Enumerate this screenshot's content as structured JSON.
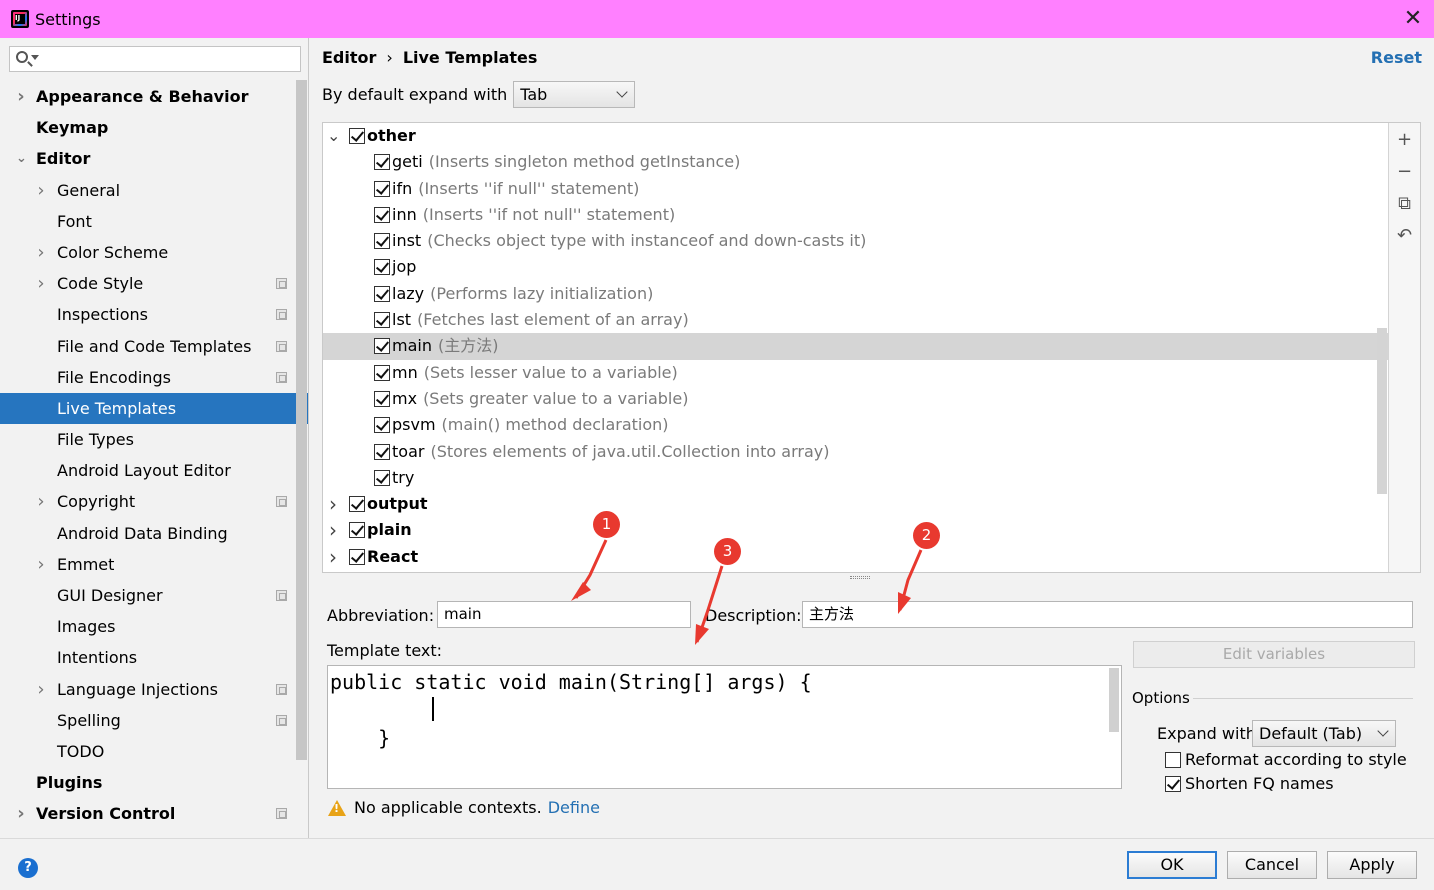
{
  "window": {
    "title": "Settings",
    "close_glyph": "✕"
  },
  "search": {
    "placeholder": ""
  },
  "sidebar": {
    "items": [
      {
        "label": "Appearance & Behavior",
        "level": 0,
        "bold": true,
        "expander": "collapsed",
        "proj": false
      },
      {
        "label": "Keymap",
        "level": 0,
        "bold": true,
        "expander": "none",
        "proj": false
      },
      {
        "label": "Editor",
        "level": 0,
        "bold": true,
        "expander": "expanded",
        "proj": false
      },
      {
        "label": "General",
        "level": 1,
        "bold": false,
        "expander": "collapsed",
        "proj": false
      },
      {
        "label": "Font",
        "level": 1,
        "bold": false,
        "expander": "none",
        "proj": false
      },
      {
        "label": "Color Scheme",
        "level": 1,
        "bold": false,
        "expander": "collapsed",
        "proj": false
      },
      {
        "label": "Code Style",
        "level": 1,
        "bold": false,
        "expander": "collapsed",
        "proj": true
      },
      {
        "label": "Inspections",
        "level": 1,
        "bold": false,
        "expander": "none",
        "proj": true
      },
      {
        "label": "File and Code Templates",
        "level": 1,
        "bold": false,
        "expander": "none",
        "proj": true
      },
      {
        "label": "File Encodings",
        "level": 1,
        "bold": false,
        "expander": "none",
        "proj": true
      },
      {
        "label": "Live Templates",
        "level": 1,
        "bold": false,
        "expander": "none",
        "proj": false,
        "selected": true
      },
      {
        "label": "File Types",
        "level": 1,
        "bold": false,
        "expander": "none",
        "proj": false
      },
      {
        "label": "Android Layout Editor",
        "level": 1,
        "bold": false,
        "expander": "none",
        "proj": false
      },
      {
        "label": "Copyright",
        "level": 1,
        "bold": false,
        "expander": "collapsed",
        "proj": true
      },
      {
        "label": "Android Data Binding",
        "level": 1,
        "bold": false,
        "expander": "none",
        "proj": false
      },
      {
        "label": "Emmet",
        "level": 1,
        "bold": false,
        "expander": "collapsed",
        "proj": false
      },
      {
        "label": "GUI Designer",
        "level": 1,
        "bold": false,
        "expander": "none",
        "proj": true
      },
      {
        "label": "Images",
        "level": 1,
        "bold": false,
        "expander": "none",
        "proj": false
      },
      {
        "label": "Intentions",
        "level": 1,
        "bold": false,
        "expander": "none",
        "proj": false
      },
      {
        "label": "Language Injections",
        "level": 1,
        "bold": false,
        "expander": "collapsed",
        "proj": true
      },
      {
        "label": "Spelling",
        "level": 1,
        "bold": false,
        "expander": "none",
        "proj": true
      },
      {
        "label": "TODO",
        "level": 1,
        "bold": false,
        "expander": "none",
        "proj": false
      },
      {
        "label": "Plugins",
        "level": 0,
        "bold": true,
        "expander": "none",
        "proj": false
      },
      {
        "label": "Version Control",
        "level": 0,
        "bold": true,
        "expander": "collapsed",
        "proj": true
      }
    ]
  },
  "header": {
    "breadcrumb": [
      "Editor",
      "Live Templates"
    ],
    "breadcrumb_sep": "›",
    "reset_label": "Reset"
  },
  "expand": {
    "label": "By default expand with",
    "value": "Tab"
  },
  "templates": {
    "rows": [
      {
        "type": "group",
        "name": "other",
        "expanded": true,
        "checked": true
      },
      {
        "type": "item",
        "name": "geti",
        "desc": "(Inserts singleton method getInstance)",
        "checked": true
      },
      {
        "type": "item",
        "name": "ifn",
        "desc": "(Inserts ''if null'' statement)",
        "checked": true
      },
      {
        "type": "item",
        "name": "inn",
        "desc": "(Inserts ''if not null'' statement)",
        "checked": true
      },
      {
        "type": "item",
        "name": "inst",
        "desc": "(Checks object type with instanceof and down-casts it)",
        "checked": true
      },
      {
        "type": "item",
        "name": "jop",
        "desc": "",
        "checked": true
      },
      {
        "type": "item",
        "name": "lazy",
        "desc": "(Performs lazy initialization)",
        "checked": true
      },
      {
        "type": "item",
        "name": "lst",
        "desc": "(Fetches last element of an array)",
        "checked": true
      },
      {
        "type": "item",
        "name": "main",
        "desc": "(主方法)",
        "checked": true,
        "selected": true
      },
      {
        "type": "item",
        "name": "mn",
        "desc": "(Sets lesser value to a variable)",
        "checked": true
      },
      {
        "type": "item",
        "name": "mx",
        "desc": "(Sets greater value to a variable)",
        "checked": true
      },
      {
        "type": "item",
        "name": "psvm",
        "desc": "(main() method declaration)",
        "checked": true
      },
      {
        "type": "item",
        "name": "toar",
        "desc": "(Stores elements of java.util.Collection into array)",
        "checked": true
      },
      {
        "type": "item",
        "name": "try",
        "desc": "",
        "checked": true
      },
      {
        "type": "group",
        "name": "output",
        "expanded": false,
        "checked": true
      },
      {
        "type": "group",
        "name": "plain",
        "expanded": false,
        "checked": true
      },
      {
        "type": "group",
        "name": "React",
        "expanded": false,
        "checked": true
      }
    ],
    "tools": {
      "add": "+",
      "remove": "−",
      "copy": "⧉",
      "revert": "↶"
    }
  },
  "editor": {
    "abbreviation_label": "Abbreviation:",
    "abbreviation_value": "main",
    "description_label": "Description:",
    "description_value": "主方法",
    "template_text_label": "Template text:",
    "template_text": "public static void main(String[] args) {\n        \n    }",
    "edit_variables_label": "Edit variables"
  },
  "options": {
    "title": "Options",
    "expand_with_label": "Expand with",
    "expand_with_value": "Default (Tab)",
    "reformat_label": "Reformat according to style",
    "reformat_checked": false,
    "shorten_label": "Shorten FQ names",
    "shorten_checked": true
  },
  "warning": {
    "text": "No applicable contexts.",
    "link": "Define"
  },
  "annotations": [
    "1",
    "2",
    "3"
  ],
  "footer": {
    "help": "?",
    "ok": "OK",
    "cancel": "Cancel",
    "apply": "Apply"
  },
  "colors": {
    "titlebar": "#ff80ff",
    "selection": "#2675bf",
    "link": "#2470b3",
    "annotation": "#e8392f",
    "warning": "#e8a317"
  }
}
